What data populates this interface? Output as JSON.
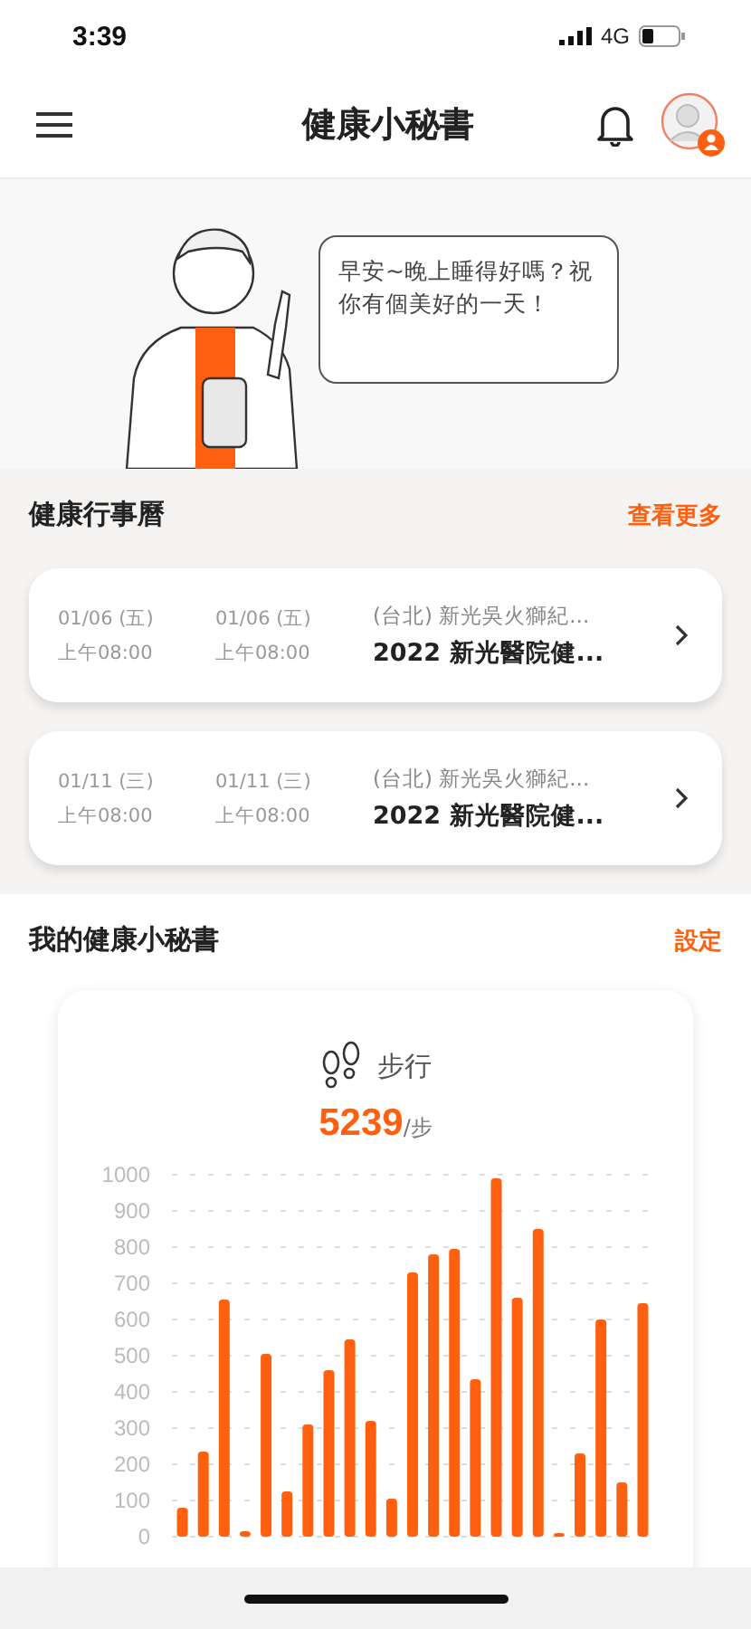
{
  "status_bar": {
    "time": "3:39",
    "network": "4G"
  },
  "header": {
    "title": "健康小秘書"
  },
  "greeting": {
    "message": "早安~晚上睡得好嗎？祝你有個美好的一天！"
  },
  "calendar": {
    "title": "健康行事曆",
    "more_link": "查看更多",
    "events": [
      {
        "start_date": "01/06 (五)",
        "start_time": "上午08:00",
        "end_date": "01/06 (五)",
        "end_time": "上午08:00",
        "location": "(台北) 新光吳火獅紀...",
        "name": "2022 新光醫院健..."
      },
      {
        "start_date": "01/11 (三)",
        "start_time": "上午08:00",
        "end_date": "01/11 (三)",
        "end_time": "上午08:00",
        "location": "(台北) 新光吳火獅紀...",
        "name": "2022 新光醫院健..."
      }
    ]
  },
  "secretary": {
    "title": "我的健康小秘書",
    "settings_link": "設定",
    "activity": {
      "label": "步行",
      "value": "5239",
      "unit": "/步",
      "chart_data": {
        "type": "bar",
        "grid": true,
        "ylim": [
          0,
          1000
        ],
        "yticks": [
          0,
          100,
          200,
          300,
          400,
          500,
          600,
          700,
          800,
          900,
          1000
        ],
        "series": [
          {
            "color": "#ff6010",
            "values": [
              80,
              235,
              655,
              15,
              505,
              125,
              310,
              460,
              545,
              320,
              105,
              730,
              780,
              795,
              435,
              990,
              660,
              850,
              10,
              230,
              600,
              150,
              645
            ]
          }
        ]
      }
    }
  }
}
